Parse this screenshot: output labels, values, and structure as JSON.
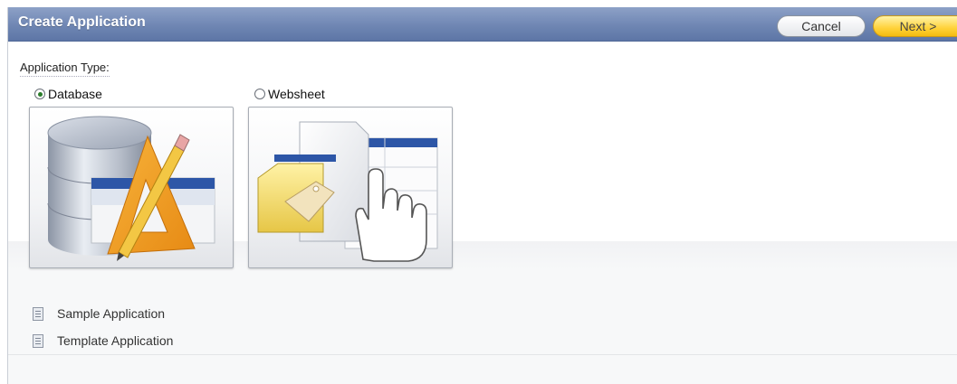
{
  "header": {
    "title": "Create Application",
    "cancel_label": "Cancel",
    "next_label": "Next >"
  },
  "section_label": "Application Type:",
  "app_types": [
    {
      "label": "Database",
      "selected": true,
      "icon": "database-design-icon"
    },
    {
      "label": "Websheet",
      "selected": false,
      "icon": "websheet-hand-icon"
    }
  ],
  "links": [
    {
      "label": "Sample Application",
      "icon": "document-icon"
    },
    {
      "label": "Template Application",
      "icon": "document-icon"
    }
  ],
  "colors": {
    "header_blue": "#6f86b3",
    "next_button_yellow": "#ffd23a",
    "selected_radio_green": "#2a7d2a"
  }
}
